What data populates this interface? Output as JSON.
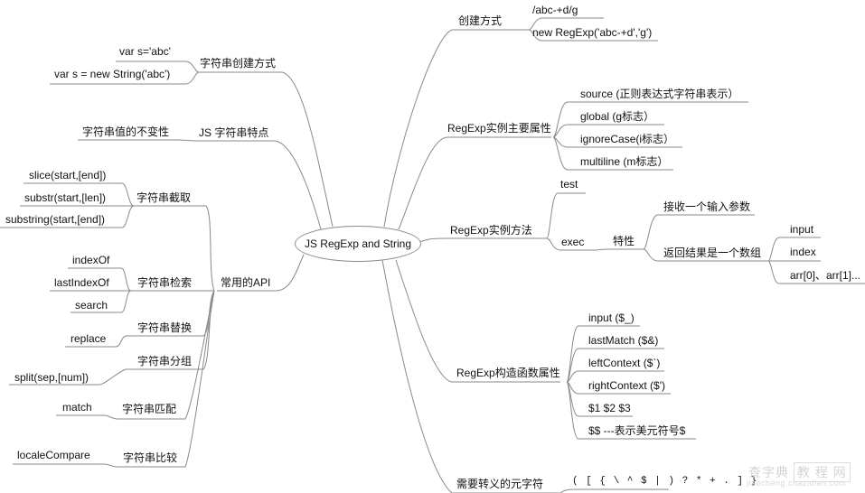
{
  "title": "JS RegExp and String",
  "left": {
    "string_create": {
      "label": "字符串创建方式",
      "children": [
        "var s='abc'",
        "var s = new String('abc')"
      ]
    },
    "string_feature": {
      "label": "JS 字符串特点",
      "children": [
        "字符串值的不变性"
      ]
    },
    "common_api": {
      "label": "常用的API",
      "groups": [
        {
          "label": "字符串截取",
          "children": [
            "slice(start,[end])",
            "substr(start,[len])",
            "substring(start,[end])"
          ]
        },
        {
          "label": "字符串检索",
          "children": [
            "indexOf",
            "lastIndexOf",
            "search"
          ]
        },
        {
          "label": "字符串替换",
          "children": [
            "replace"
          ]
        },
        {
          "label": "字符串分组",
          "children": [
            "split(sep,[num])"
          ]
        },
        {
          "label": "字符串匹配",
          "children": [
            "match"
          ]
        },
        {
          "label": "字符串比较",
          "children": [
            "localeCompare"
          ]
        }
      ]
    }
  },
  "right": {
    "create": {
      "label": "创建方式",
      "children": [
        "/abc-+d/g",
        "new RegExp('abc-+d','g')"
      ]
    },
    "instance_props": {
      "label": "RegExp实例主要属性",
      "children": [
        "source (正则表达式字符串表示）",
        "global (g标志）",
        "ignoreCase(i标志）",
        "multiline (m标志）"
      ]
    },
    "instance_methods": {
      "label": "RegExp实例方法",
      "test": "test",
      "exec": "exec",
      "feature": "特性",
      "feature_children": [
        "接收一个输入参数",
        "返回结果是一个数组"
      ],
      "result_children": [
        "input",
        "index",
        "arr[0]、arr[1]..."
      ]
    },
    "ctor_props": {
      "label": "RegExp构造函数属性",
      "children": [
        "input ($_)",
        "lastMatch ($&)",
        "leftContext ($`)",
        "rightContext ($')",
        "$1 $2 $3",
        "$$  ---表示美元符号$"
      ]
    },
    "escape": {
      "label": "需要转义的元字符",
      "value": "( [ { \\ ^ $ | ) ? * + . ] }"
    }
  },
  "watermark": {
    "text": "查字典",
    "boxed": "教 程 网",
    "url": "jiaocheng.chazidian.com"
  },
  "colors": {
    "line": "#8a8a8a",
    "text": "#111111",
    "background": "#ffffff"
  }
}
